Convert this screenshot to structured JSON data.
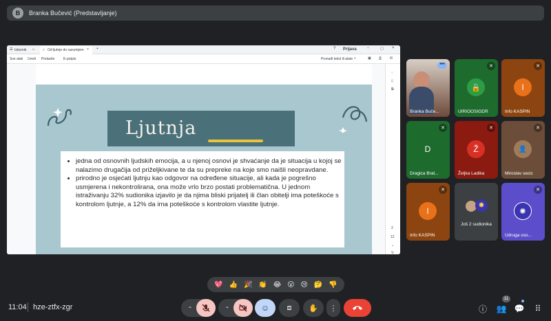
{
  "presenter": {
    "initial": "B",
    "name": "Branka Bučević (Predstavljanje)"
  },
  "browser": {
    "tabs": [
      "Izbornik",
      "Od ljutnje do razumijem"
    ],
    "sign_in": "Prijava",
    "toolbar": [
      "Sve alati",
      "Uredi",
      "Prelazite",
      "E-potpis"
    ],
    "search_label": "Pronađi tekst ili alate",
    "page_indicator": [
      "2",
      "12"
    ]
  },
  "slide": {
    "title": "Ljutnja",
    "bullets": [
      "jedna od osnovnih ljudskih emocija, a u njenoj osnovi je shvaćanje da je situacija u kojoj se nalazimo drugačija od priželjkivane te da su prepreke na koje smo naišli neopravdane.",
      "prirodno je osjećati ljutnju kao odgovor na određene situacije, ali kada je pogrešno usmjerena i nekontrolirana, ona može vrlo brzo postati problematična. U jednom istraživanju 32% sudionika izjavilo je da njima bliski prijatelj ili član obitelji ima poteškoće s kontrolom ljutnje, a 12% da ima poteškoće s kontrolom vlastite ljutnje."
    ]
  },
  "participants": [
    {
      "name": "Branka Buče...",
      "initial": "",
      "bg": "#7d6e63",
      "avatar": ""
    },
    {
      "name": "UIRIOOSIGDR",
      "initial": "",
      "bg": "#1e6b2e",
      "avatar": "#2e9b45"
    },
    {
      "name": "Info KASPIN",
      "initial": "I",
      "bg": "#8c4510",
      "avatar": "#e8711a"
    },
    {
      "name": "Dragica Brat...",
      "initial": "D",
      "bg": "#1e6b2e",
      "avatar": "#1e6b2e"
    },
    {
      "name": "Željka Ladika",
      "initial": "Ž",
      "bg": "#8b1a10",
      "avatar": "#d93025"
    },
    {
      "name": "Miroslav secic",
      "initial": "",
      "bg": "#6b4d3a",
      "avatar": "#a07b5a"
    },
    {
      "name": "Info KASPIN",
      "initial": "I",
      "bg": "#8c4510",
      "avatar": "#e8711a"
    },
    {
      "name": "Još 2 sudionika",
      "initial": "",
      "bg": "#3c4043",
      "avatar": ""
    },
    {
      "name": "Udruga oso...",
      "initial": "",
      "bg": "#5c4dcb",
      "avatar": "#3b34b0"
    }
  ],
  "reactions": [
    "💖",
    "👍",
    "🎉",
    "👏",
    "😂",
    "😮",
    "😢",
    "🤔",
    "👎"
  ],
  "footer": {
    "time": "11:04",
    "meeting_code": "hze-ztfx-zgr",
    "participant_count": "11"
  },
  "colors": {
    "end_call": "#ea4335",
    "muted_btn": "#f5c6c2",
    "emoji_btn": "#c2d7f8",
    "slide_teal": "#4a7079"
  }
}
